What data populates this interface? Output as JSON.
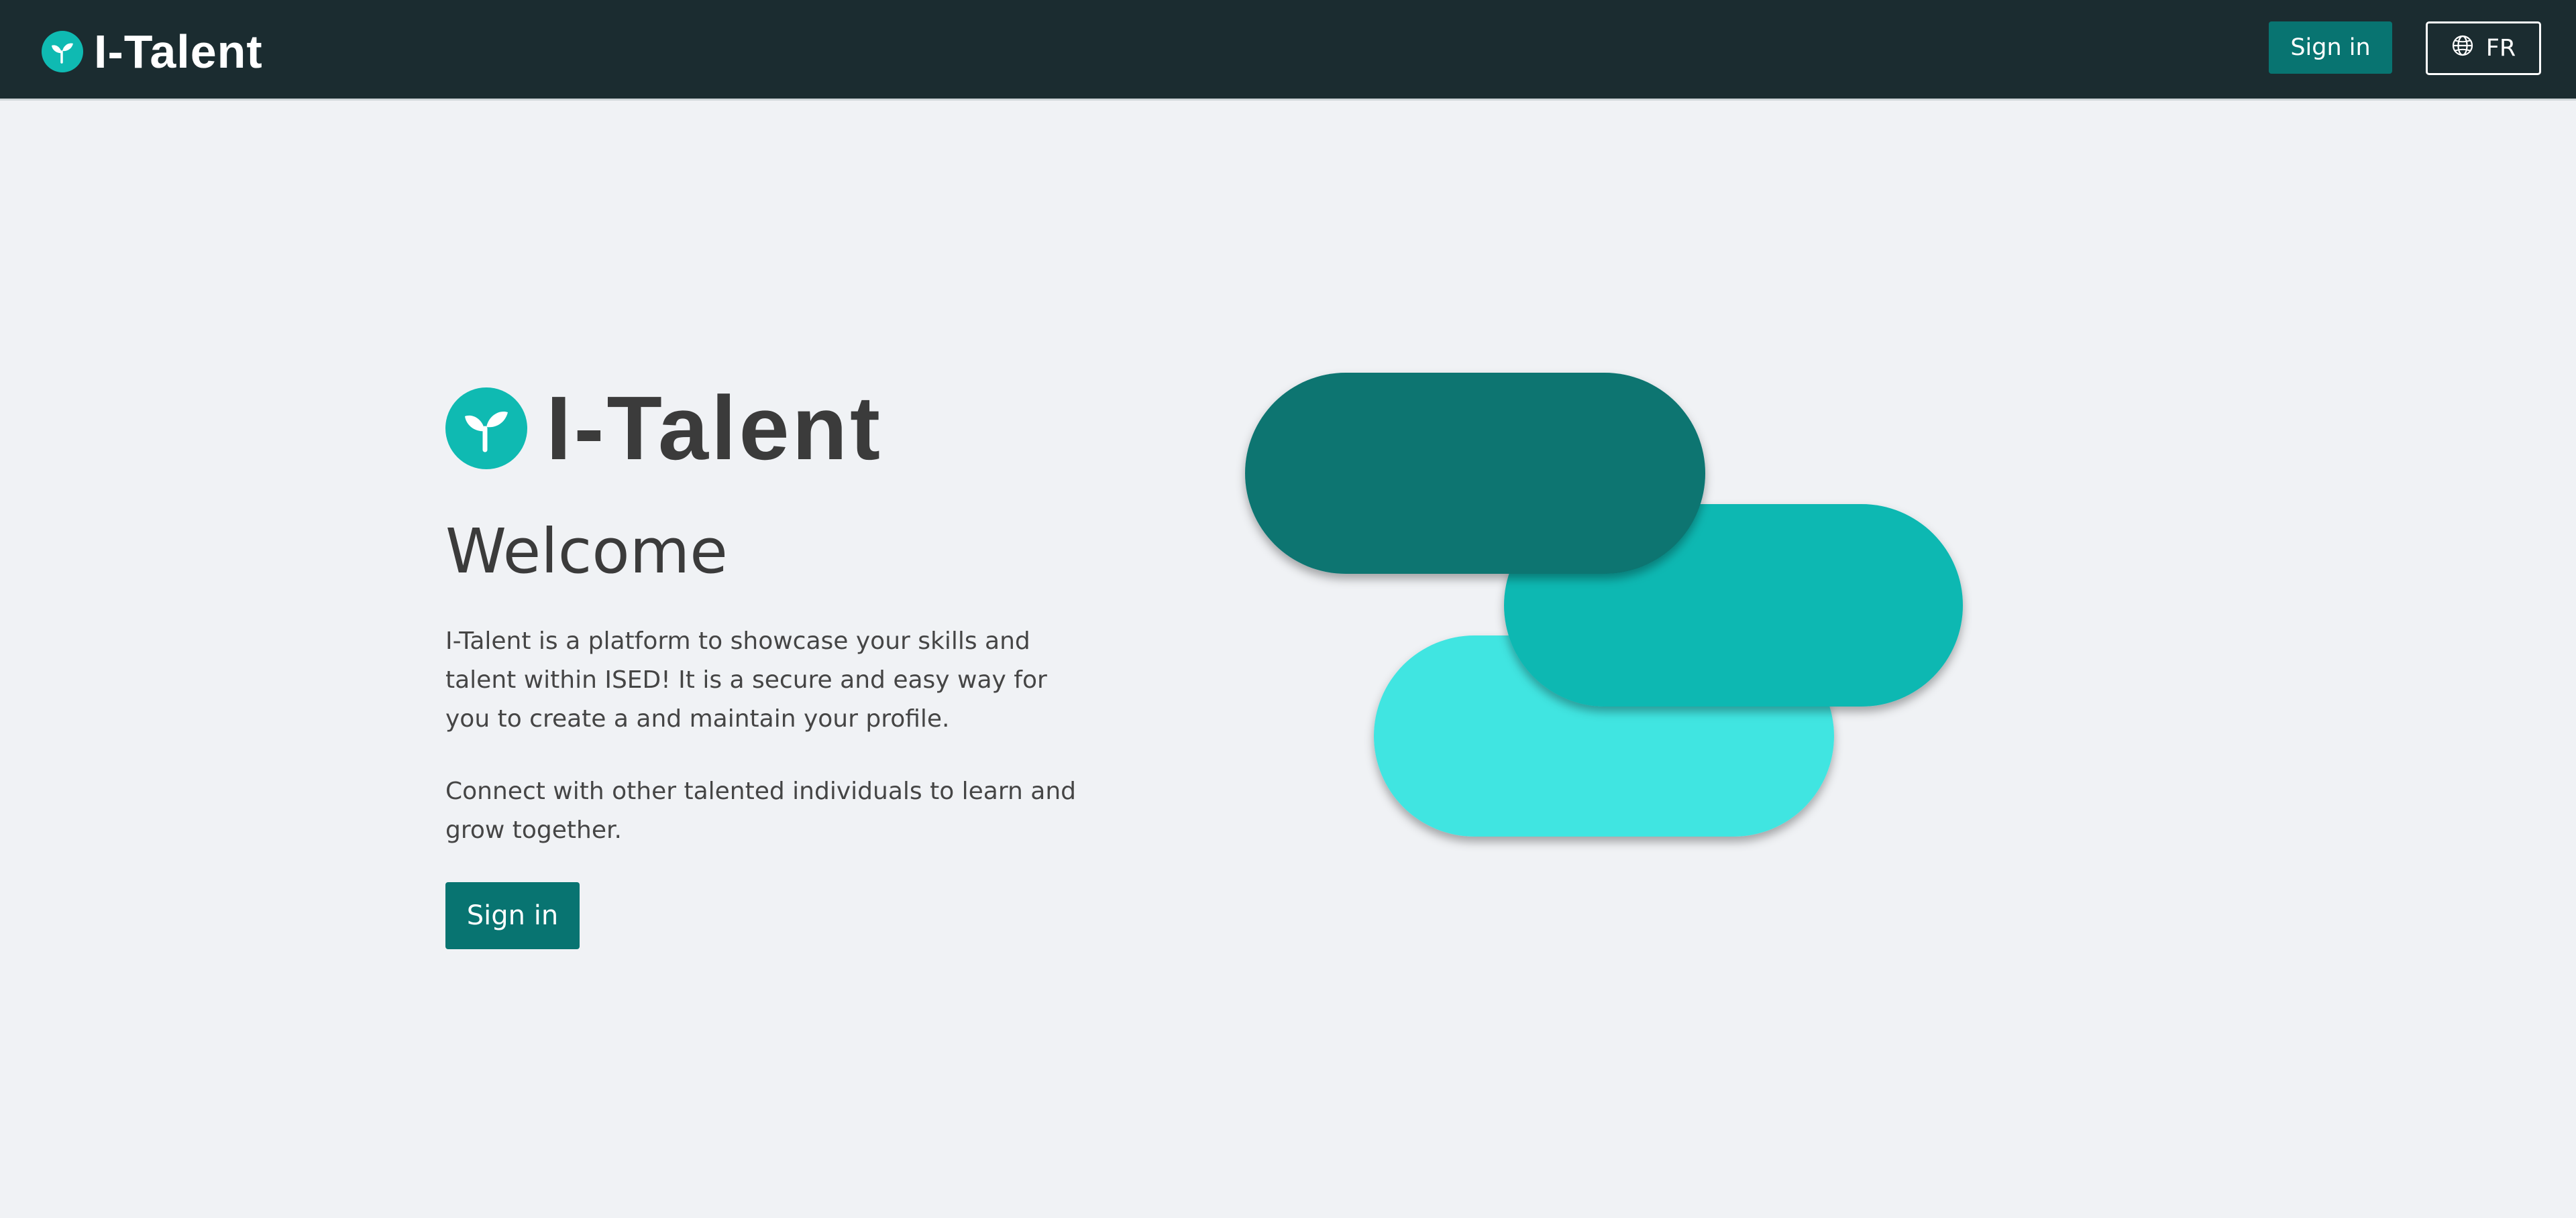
{
  "header": {
    "brand_title": "I-Talent",
    "logo_icon": "sprout-icon",
    "signin_label": "Sign in",
    "language_label": "FR",
    "language_icon": "globe-icon"
  },
  "hero": {
    "brand_title": "I-Talent",
    "logo_icon": "sprout-icon",
    "heading": "Welcome",
    "paragraph1": "I-Talent is a platform to showcase your skills and talent within ISED! It is a secure and easy way for you to create a and maintain your profile.",
    "paragraph2": "Connect with other talented individuals to learn and grow together.",
    "signin_label": "Sign in"
  },
  "colors": {
    "header_bg": "#1b2c30",
    "page_bg": "#f0f2f5",
    "primary": "#087471",
    "logo_teal": "#0fbab2",
    "pill_dark": "#087471",
    "pill_mid": "#08b8b2",
    "pill_light": "#40e5e1"
  }
}
